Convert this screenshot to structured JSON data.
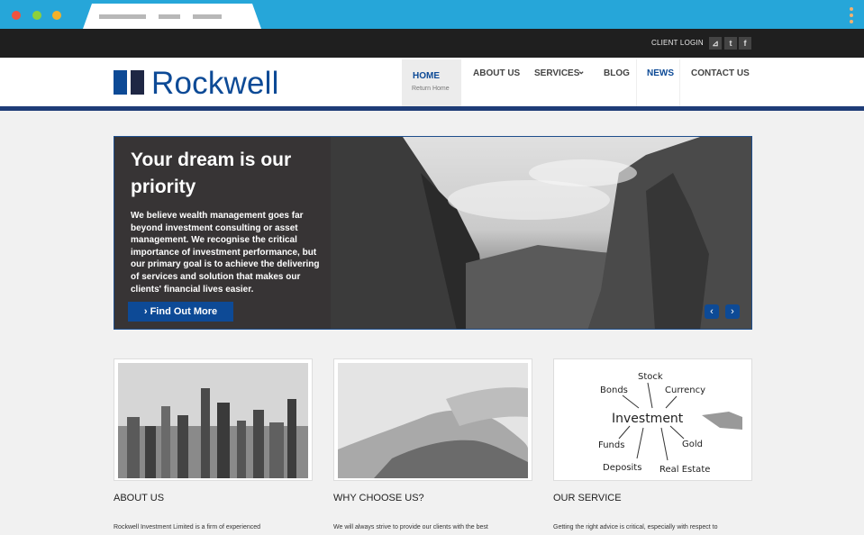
{
  "topbar": {
    "client_login": "CLIENT LOGIN",
    "social": [
      {
        "icon": "rss-icon",
        "glyph": "⊿"
      },
      {
        "icon": "twitter-icon",
        "glyph": "t"
      },
      {
        "icon": "facebook-icon",
        "glyph": "f"
      }
    ]
  },
  "logo": {
    "text": "Rockwell"
  },
  "nav": {
    "home": "HOME",
    "home_sub": "Return Home",
    "about": "ABOUT US",
    "services": "SERVICES",
    "services_caret": "⌄",
    "blog": "BLOG",
    "news": "NEWS",
    "contact": "CONTACT US"
  },
  "hero": {
    "title": "Your dream is our priority",
    "body": "We believe wealth management goes far beyond investment consulting or asset management. We recognise the critical importance of investment performance, but our primary goal is to achieve the delivering of services and solution that makes our clients' financial lives easier.",
    "cta": "› Find Out More",
    "prev": "‹",
    "next": "›"
  },
  "cards": [
    {
      "title": "ABOUT US",
      "text": "Rockwell Investment Limited is a firm of experienced"
    },
    {
      "title": "WHY CHOOSE US?",
      "text": "We will always strive to provide our clients with the best"
    },
    {
      "title": "OUR SERVICE",
      "text": "Getting the right advice is critical, especially with respect to",
      "diagram": {
        "center": "Investment",
        "items": [
          "Stock",
          "Bonds",
          "Currency",
          "Funds",
          "Gold",
          "Deposits",
          "Real Estate"
        ]
      }
    }
  ],
  "colors": {
    "browser": "#26a6d9",
    "brand": "#0d4a96",
    "topbar": "#1f1f1f",
    "hero_panel": "#373435"
  }
}
